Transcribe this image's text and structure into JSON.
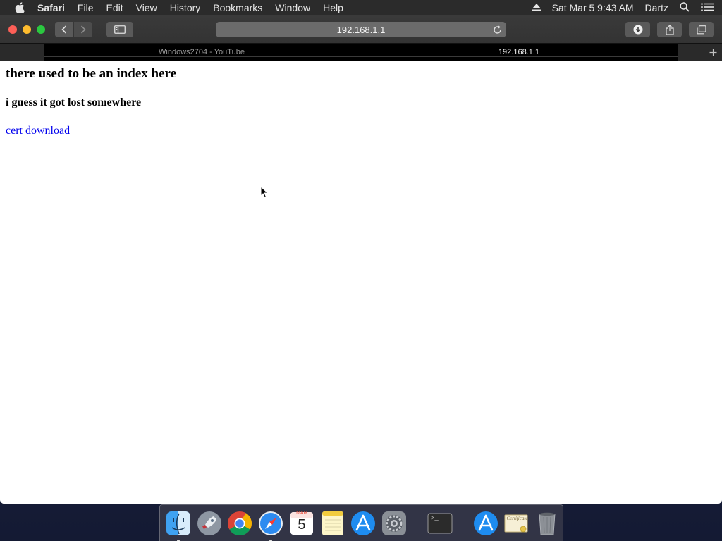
{
  "menubar": {
    "app_name": "Safari",
    "items": [
      "File",
      "Edit",
      "View",
      "History",
      "Bookmarks",
      "Window",
      "Help"
    ],
    "datetime": "Sat Mar 5  9:43 AM",
    "user": "Dartz"
  },
  "toolbar": {
    "address": "192.168.1.1"
  },
  "tabs": [
    {
      "label": "Windows2704 - YouTube",
      "active": false
    },
    {
      "label": "192.168.1.1",
      "active": true
    }
  ],
  "page": {
    "heading": "there used to be an index here",
    "subheading": "i guess it got lost somewhere",
    "link": "cert download"
  },
  "dock": {
    "calendar_month": "MAR",
    "calendar_day": "5",
    "terminal_prompt": ">_",
    "certificate_text": "Certificate"
  }
}
